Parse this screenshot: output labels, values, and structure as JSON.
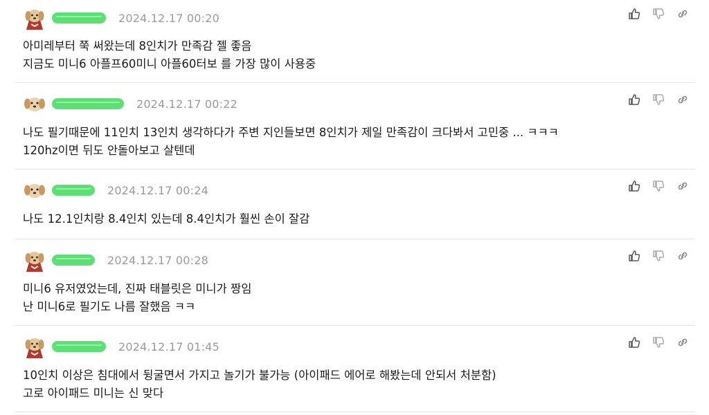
{
  "comments": [
    {
      "date": "2024.12.17 00:20",
      "lines": [
        "아미레부터 쭉 써왔는데 8인치가 만족감 젤 좋음",
        "지금도 미니6 아플프60미니 아플60터보 를 가장 많이 사용중"
      ],
      "avatar": "dog-with-red-cape"
    },
    {
      "date": "2024.12.17 00:22",
      "lines": [
        "나도 필기때문에 11인치 13인치 생각하다가 주변 지인들보면 8인치가 제일 만족감이 크다봐서 고민중 ... ㅋㅋㅋ",
        "120hz이면 뒤도 안돌아보고 살텐데"
      ],
      "avatar": "dog-face"
    },
    {
      "date": "2024.12.17 00:24",
      "lines": [
        "나도 12.1인치랑 8.4인치 있는데 8.4인치가 훨씬 손이 잘감"
      ],
      "avatar": "dog-face"
    },
    {
      "date": "2024.12.17 00:28",
      "lines": [
        "미니6 유저였었는데, 진짜 태블릿은 미니가 짱임",
        "난 미니6로 필기도 나름 잘했음 ㅋㅋ"
      ],
      "avatar": "dog-with-red-cape"
    },
    {
      "date": "2024.12.17 01:45",
      "lines": [
        "10인치 이상은 침대에서 뒹굴면서 가지고 놀기가 불가능 (아이패드 에어로 해봤는데 안되서 처분함)",
        "고로 아이패드 미니는 신 맞다"
      ],
      "avatar": "dog-with-red-cape"
    }
  ],
  "icons": {
    "like": "thumbs-up-icon",
    "dislike": "thumbs-down-icon",
    "link": "link-icon"
  },
  "colors": {
    "nickname_scribble": "#4fde68",
    "date": "#9a9a9a",
    "text": "#1a1a1a",
    "divider": "#e5e5e5"
  }
}
